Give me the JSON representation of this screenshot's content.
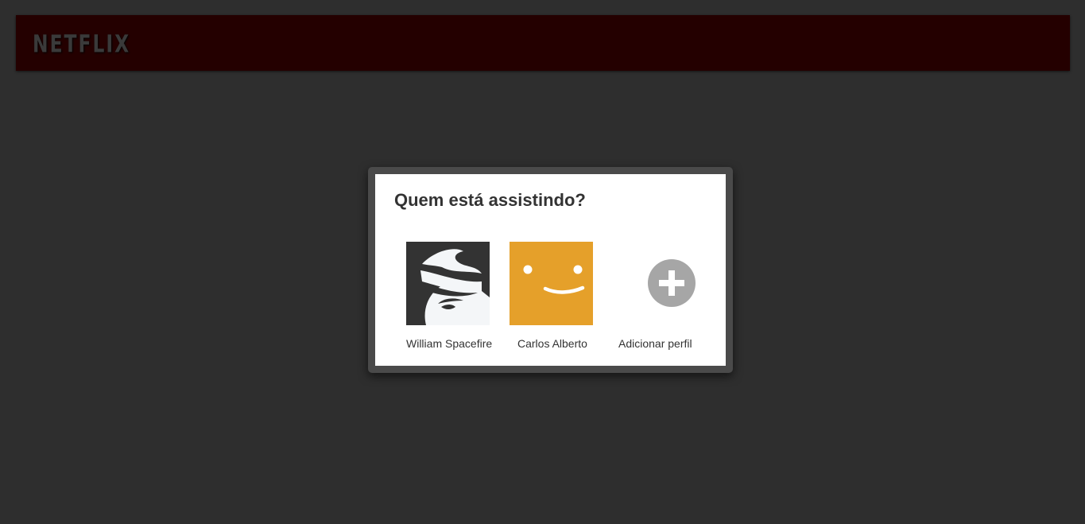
{
  "header": {
    "logo_text": "NETFLIX"
  },
  "dialog": {
    "title": "Quem está assistindo?",
    "profiles": [
      {
        "name": "William Spacefire",
        "avatar": "masked-face-avatar",
        "color": "#333333"
      },
      {
        "name": "Carlos Alberto",
        "avatar": "smiley-face-avatar",
        "color": "#e5a02a"
      },
      {
        "name": "Adicionar perfil",
        "avatar": "plus-icon",
        "color": "#a6a6a6"
      }
    ]
  },
  "colors": {
    "page_background": "#2e2e2e",
    "header_background": "#240000",
    "dialog_frame": "#4a4a4a"
  }
}
